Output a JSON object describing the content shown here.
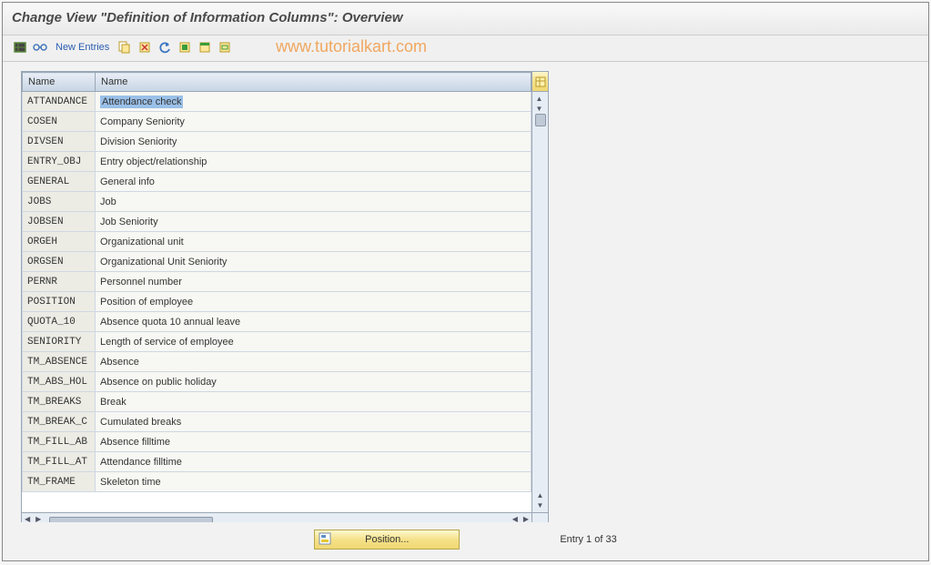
{
  "title": "Change View \"Definition of Information Columns\": Overview",
  "toolbar": {
    "new_entries": "New Entries"
  },
  "watermark": "www.tutorialkart.com",
  "columns": {
    "c1": "Name",
    "c2": "Name"
  },
  "rows": [
    {
      "code": "ATTANDANCE",
      "desc": "Attendance check"
    },
    {
      "code": "COSEN",
      "desc": "Company Seniority"
    },
    {
      "code": "DIVSEN",
      "desc": "Division Seniority"
    },
    {
      "code": "ENTRY_OBJ",
      "desc": "Entry object/relationship"
    },
    {
      "code": "GENERAL",
      "desc": "General info"
    },
    {
      "code": "JOBS",
      "desc": "Job"
    },
    {
      "code": "JOBSEN",
      "desc": "Job Seniority"
    },
    {
      "code": "ORGEH",
      "desc": "Organizational unit"
    },
    {
      "code": "ORGSEN",
      "desc": "Organizational Unit Seniority"
    },
    {
      "code": "PERNR",
      "desc": "Personnel number"
    },
    {
      "code": "POSITION",
      "desc": "Position of employee"
    },
    {
      "code": "QUOTA_10",
      "desc": "Absence quota 10 annual leave"
    },
    {
      "code": "SENIORITY",
      "desc": "Length of service of employee"
    },
    {
      "code": "TM_ABSENCE",
      "desc": "Absence"
    },
    {
      "code": "TM_ABS_HOL",
      "desc": "Absence on public holiday"
    },
    {
      "code": "TM_BREAKS",
      "desc": "Break"
    },
    {
      "code": "TM_BREAK_C",
      "desc": "Cumulated breaks"
    },
    {
      "code": "TM_FILL_AB",
      "desc": "Absence filltime"
    },
    {
      "code": "TM_FILL_AT",
      "desc": "Attendance filltime"
    },
    {
      "code": "TM_FRAME",
      "desc": "Skeleton time"
    }
  ],
  "footer": {
    "position_btn": "Position...",
    "entry_text": "Entry 1 of 33"
  }
}
